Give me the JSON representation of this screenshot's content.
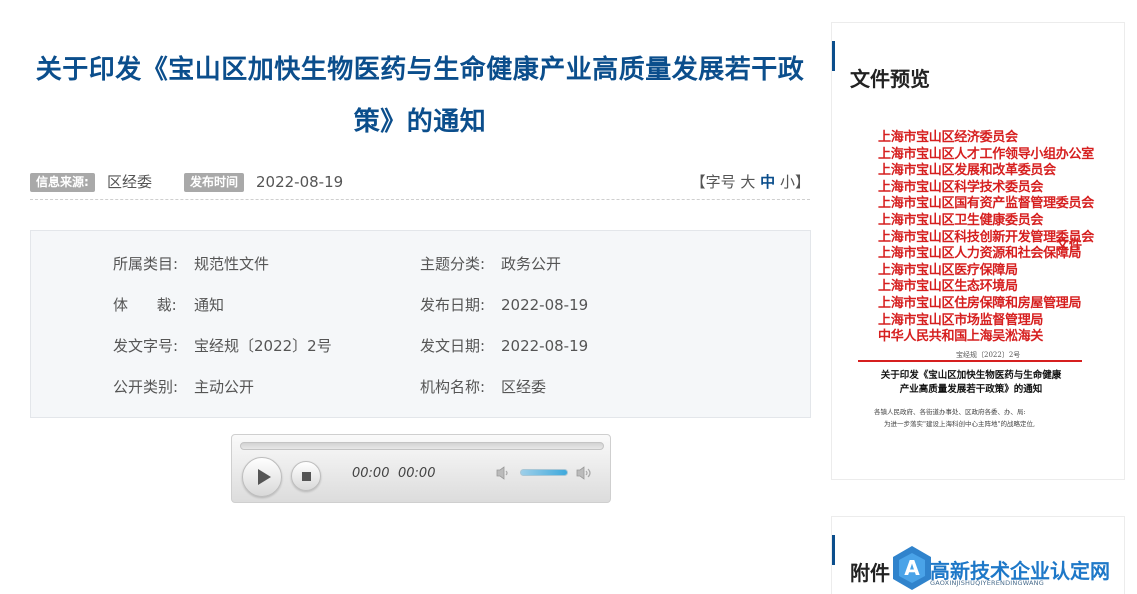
{
  "article": {
    "title_line1": "关于印发《宝山区加快生物医药与生命健康产业高质量发展若干政",
    "title_line2": "策》的通知"
  },
  "meta": {
    "source_label": "信息来源:",
    "source_value": "区经委",
    "date_label": "发布时间",
    "date_value": "2022-08-19",
    "font_size": {
      "open": "【字号",
      "large": "大",
      "medium": "中",
      "small": "小",
      "close": "】"
    }
  },
  "info": {
    "category_label": "所属类目:",
    "category_value": "规范性文件",
    "topic_label": "主题分类:",
    "topic_value": "政务公开",
    "genre_label": "体      裁:",
    "genre_value": "通知",
    "publish_label": "发布日期:",
    "publish_value": "2022-08-19",
    "doc_no_label": "发文字号:",
    "doc_no_value": "宝经规〔2022〕2号",
    "issue_label": "发文日期:",
    "issue_value": "2022-08-19",
    "disclosure_label": "公开类别:",
    "disclosure_value": "主动公开",
    "org_label": "机构名称:",
    "org_value": "区经委"
  },
  "player": {
    "current_time": "00:00",
    "duration": "00:00",
    "progress": 0,
    "volume": 0.8
  },
  "sidebar": {
    "preview_title": "文件预览",
    "attachment_title": "附件"
  },
  "preview": {
    "issuers": [
      "上海市宝山区经济委员会",
      "上海市宝山区人才工作领导小组办公室",
      "上海市宝山区发展和改革委员会",
      "上海市宝山区科学技术委员会",
      "上海市宝山区国有资产监督管理委员会",
      "上海市宝山区卫生健康委员会",
      "上海市宝山区科技创新开发管理委员会",
      "上海市宝山区人力资源和社会保障局",
      "上海市宝山区医疗保障局",
      "上海市宝山区生态环境局",
      "上海市宝山区住房保障和房屋管理局",
      "上海市宝山区市场监督管理局",
      "中华人民共和国上海吴淞海关"
    ],
    "doc_word": "文件",
    "doc_number": "宝经规〔2022〕2号",
    "doc_title_line1": "关于印发《宝山区加快生物医药与生命健康",
    "doc_title_line2": "产业高质量发展若干政策》的通知",
    "body_line1": "各镇人民政府、各街道办事处、区政府各委、办、局:",
    "body_line2": "为进一步落实\"建设上海科创中心主阵地\"的战略定位,"
  },
  "watermark": {
    "text": "高新技术企业认定网",
    "sub": "GAOXINJISHUQIYERENDINGWANG"
  }
}
